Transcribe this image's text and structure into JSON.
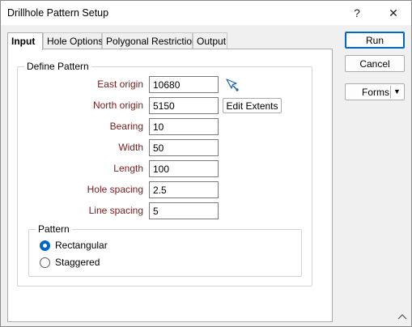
{
  "window": {
    "title": "Drillhole Pattern Setup",
    "help_glyph": "?",
    "close_glyph": "✕"
  },
  "tabs": [
    {
      "label": "Input",
      "active": true
    },
    {
      "label": "Hole Options",
      "active": false
    },
    {
      "label": "Polygonal Restriction",
      "active": false
    },
    {
      "label": "Output",
      "active": false
    }
  ],
  "define_pattern": {
    "legend": "Define Pattern",
    "fields": [
      {
        "label": "East origin",
        "value": "10680"
      },
      {
        "label": "North origin",
        "value": "5150"
      },
      {
        "label": "Bearing",
        "value": "10"
      },
      {
        "label": "Width",
        "value": "50"
      },
      {
        "label": "Length",
        "value": "100"
      },
      {
        "label": "Hole spacing",
        "value": "2.5"
      },
      {
        "label": "Line spacing",
        "value": "5"
      }
    ],
    "edit_extents_label": "Edit Extents"
  },
  "pattern": {
    "legend": "Pattern",
    "options": [
      {
        "label": "Rectangular",
        "checked": true
      },
      {
        "label": "Staggered",
        "checked": false
      }
    ]
  },
  "actions": {
    "run": "Run",
    "cancel": "Cancel",
    "forms": "Forms"
  },
  "colors": {
    "label_red": "#7a1a1a",
    "accent": "#0067c0"
  }
}
